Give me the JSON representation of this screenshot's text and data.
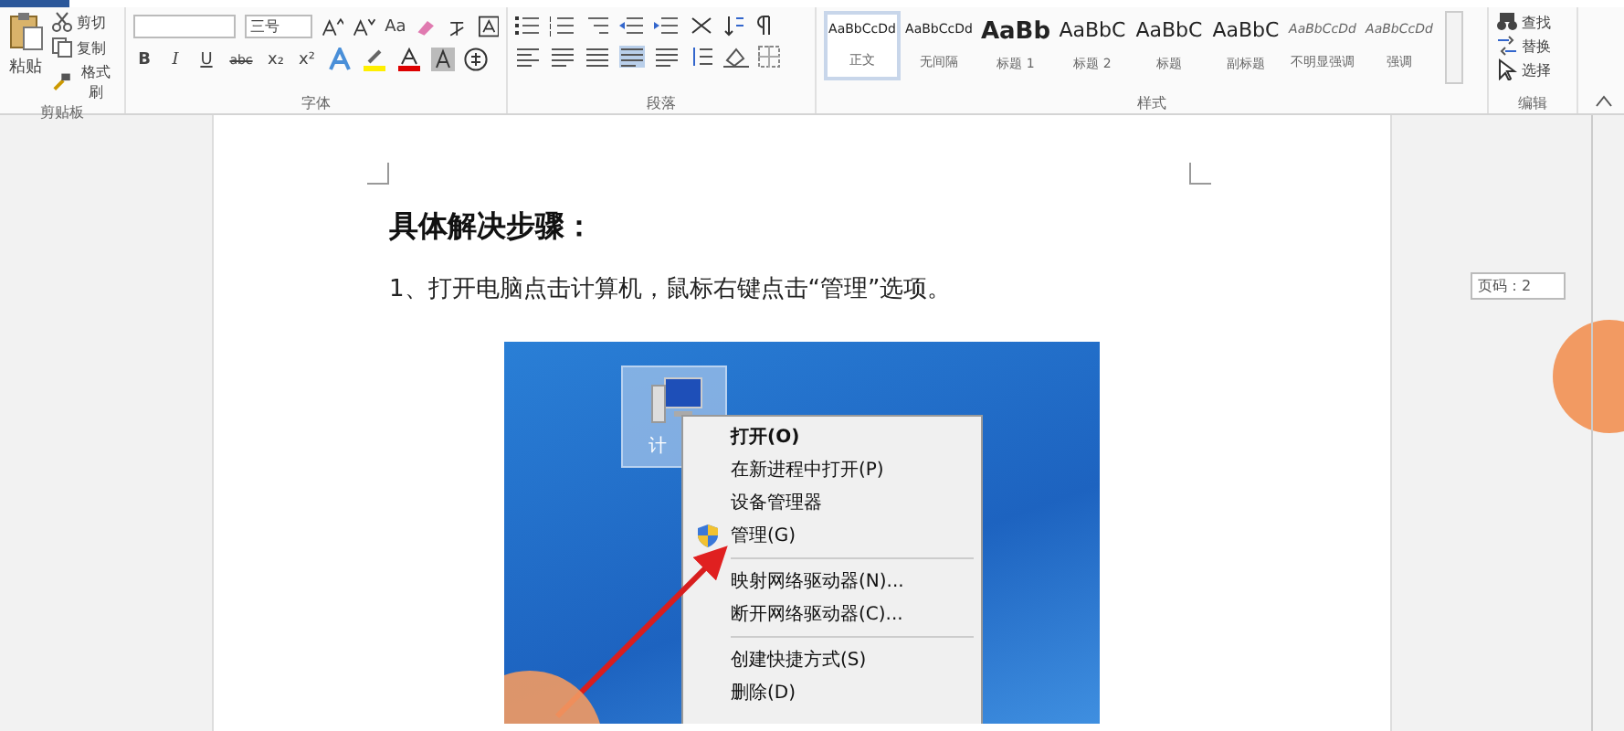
{
  "ribbon": {
    "clipboard": {
      "paste": "粘贴",
      "items": [
        {
          "label": "剪切",
          "kind": "cut"
        },
        {
          "label": "复制",
          "kind": "copy"
        },
        {
          "label": "格式刷",
          "kind": "brush"
        }
      ],
      "label": "剪贴板"
    },
    "font": {
      "font_size": "三号",
      "case_button": "Aa",
      "format_buttons": [
        {
          "label": "B",
          "kind": "bold"
        },
        {
          "label": "I",
          "kind": "italic"
        },
        {
          "label": "U",
          "kind": "underline"
        },
        {
          "label": "abc",
          "kind": "strike"
        },
        {
          "label": "x₂",
          "kind": "plain"
        },
        {
          "label": "x²",
          "kind": "plain"
        }
      ],
      "label": "字体"
    },
    "paragraph": {
      "label": "段落"
    },
    "styles": {
      "items": [
        {
          "preview": "AaBbCcDd",
          "name": "正文",
          "kind": "normal",
          "selected": true
        },
        {
          "preview": "AaBbCcDd",
          "name": "无间隔",
          "kind": "normal",
          "selected": false
        },
        {
          "preview": "AaBb",
          "name": "标题 1",
          "kind": "heading1",
          "selected": false
        },
        {
          "preview": "AaBbC",
          "name": "标题 2",
          "kind": "heading2",
          "selected": false
        },
        {
          "preview": "AaBbC",
          "name": "标题",
          "kind": "heading2",
          "selected": false
        },
        {
          "preview": "AaBbC",
          "name": "副标题",
          "kind": "heading2",
          "selected": false
        },
        {
          "preview": "AaBbCcDd",
          "name": "不明显强调",
          "kind": "emphasis",
          "selected": false
        },
        {
          "preview": "AaBbCcDd",
          "name": "强调",
          "kind": "emphasis",
          "selected": false
        }
      ],
      "label": "样式"
    },
    "editing": {
      "items": [
        {
          "label": "查找",
          "kind": "find"
        },
        {
          "label": "替换",
          "kind": "replace"
        },
        {
          "label": "选择",
          "kind": "select"
        }
      ],
      "label": "编辑"
    }
  },
  "document": {
    "heading": "具体解决步骤：",
    "paragraph": "1、打开电脑点击计算机，鼠标右键点击“管理”选项。",
    "screenshot": {
      "icon_label": "计",
      "menu": [
        {
          "label": "打开(O)",
          "kind": "default",
          "separator_above": false
        },
        {
          "label": "在新进程中打开(P)",
          "kind": "item",
          "separator_above": false
        },
        {
          "label": "设备管理器",
          "kind": "item",
          "separator_above": false
        },
        {
          "label": "管理(G)",
          "kind": "shield",
          "separator_above": false
        },
        {
          "label": "映射网络驱动器(N)...",
          "kind": "item",
          "separator_above": true
        },
        {
          "label": "断开网络驱动器(C)...",
          "kind": "item",
          "separator_above": false
        },
        {
          "label": "创建快捷方式(S)",
          "kind": "item",
          "separator_above": true
        },
        {
          "label": "删除(D)",
          "kind": "item",
          "separator_above": false
        }
      ]
    }
  },
  "page_number": "页码：2"
}
